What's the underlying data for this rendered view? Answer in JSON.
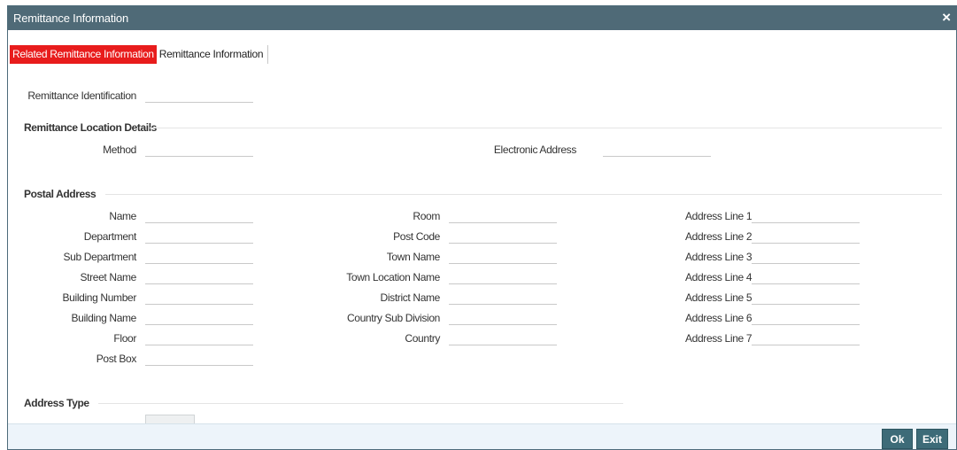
{
  "window": {
    "title": "Remittance Information",
    "close": "×"
  },
  "tabs": [
    {
      "label": "Related Remittance Information",
      "active": true
    },
    {
      "label": "Remittance Information",
      "active": false
    }
  ],
  "fields": {
    "remittance_identification": "Remittance Identification"
  },
  "sections": {
    "location": {
      "title": "Remittance Location Details",
      "method": "Method",
      "electronic_address": "Electronic Address"
    },
    "postal": {
      "title": "Postal Address",
      "col1": [
        "Name",
        "Department",
        "Sub Department",
        "Street Name",
        "Building Number",
        "Building Name",
        "Floor",
        "Post Box"
      ],
      "col2": [
        "Room",
        "Post Code",
        "Town Name",
        "Town Location Name",
        "District Name",
        "Country Sub Division",
        "Country"
      ],
      "col3": [
        "Address Line 1",
        "Address Line 2",
        "Address Line 3",
        "Address Line 4",
        "Address Line 5",
        "Address Line 6",
        "Address Line 7"
      ]
    },
    "address_type": {
      "title": "Address Type"
    }
  },
  "footer": {
    "ok": "Ok",
    "exit": "Exit"
  },
  "colors": {
    "titlebar": "#4f6a77",
    "active_tab": "#e81c1c",
    "button": "#3d6b78",
    "footer": "#edf4fa"
  }
}
